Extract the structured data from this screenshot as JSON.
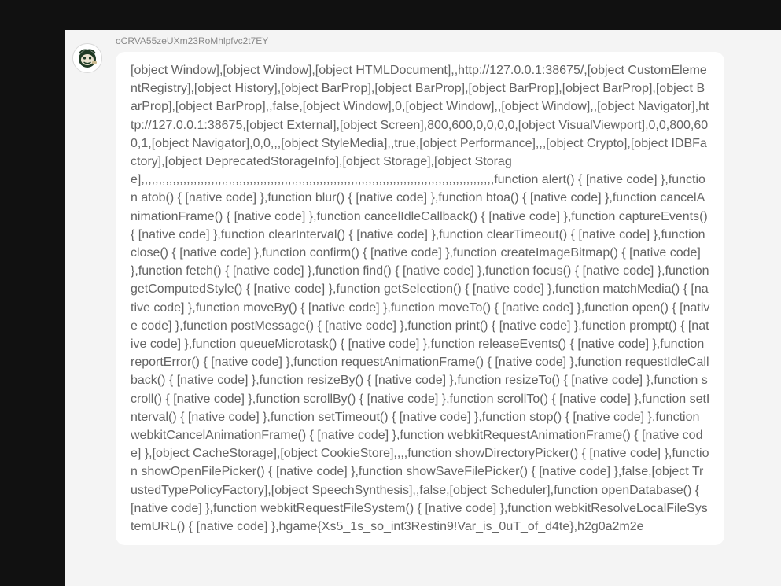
{
  "message": {
    "sender": "oCRVA55zeUXm23RoMhlpfvc2t7EY",
    "avatar_icon": "emoji-avatar-icon",
    "text": "[object Window],[object Window],[object HTMLDocument],,http://127.0.0.1:38675/,[object CustomElementRegistry],[object History],[object BarProp],[object BarProp],[object BarProp],[object BarProp],[object BarProp],[object BarProp],,false,[object Window],0,[object Window],,[object Window],,[object Navigator],http://127.0.0.1:38675,[object External],[object Screen],800,600,0,0,0,0,[object VisualViewport],0,0,800,600,1,[object Navigator],0,0,,,[object StyleMedia],,true,[object Performance],,,[object Crypto],[object IDBFactory],[object DeprecatedStorageInfo],[object Storage],[object Storage],,,,,,,,,,,,,,,,,,,,,,,,,,,,,,,,,,,,,,,,,,,,,,,,,,,,,,,,,,,,,,,,,,,,,,,,,,,,,,,,,,,,,,,,,,,,,,,,,,,,,function alert() { [native code] },function atob() { [native code] },function blur() { [native code] },function btoa() { [native code] },function cancelAnimationFrame() { [native code] },function cancelIdleCallback() { [native code] },function captureEvents() { [native code] },function clearInterval() { [native code] },function clearTimeout() { [native code] },function close() { [native code] },function confirm() { [native code] },function createImageBitmap() { [native code] },function fetch() { [native code] },function find() { [native code] },function focus() { [native code] },function getComputedStyle() { [native code] },function getSelection() { [native code] },function matchMedia() { [native code] },function moveBy() { [native code] },function moveTo() { [native code] },function open() { [native code] },function postMessage() { [native code] },function print() { [native code] },function prompt() { [native code] },function queueMicrotask() { [native code] },function releaseEvents() { [native code] },function reportError() { [native code] },function requestAnimationFrame() { [native code] },function requestIdleCallback() { [native code] },function resizeBy() { [native code] },function resizeTo() { [native code] },function scroll() { [native code] },function scrollBy() { [native code] },function scrollTo() { [native code] },function setInterval() { [native code] },function setTimeout() { [native code] },function stop() { [native code] },function webkitCancelAnimationFrame() { [native code] },function webkitRequestAnimationFrame() { [native code] },[object CacheStorage],[object CookieStore],,,,function showDirectoryPicker() { [native code] },function showOpenFilePicker() { [native code] },function showSaveFilePicker() { [native code] },false,[object TrustedTypePolicyFactory],[object SpeechSynthesis],,false,[object Scheduler],function openDatabase() { [native code] },function webkitRequestFileSystem() { [native code] },function webkitResolveLocalFileSystemURL() { [native code] },hgame{Xs5_1s_so_int3Restin9!Var_is_0uT_of_d4te},h2g0a2m2e"
  },
  "colors": {
    "page_background": "#111111",
    "panel_background": "#f4f4f4",
    "bubble_background": "#ffffff",
    "message_text": "#646464",
    "sender_text": "#888888"
  }
}
